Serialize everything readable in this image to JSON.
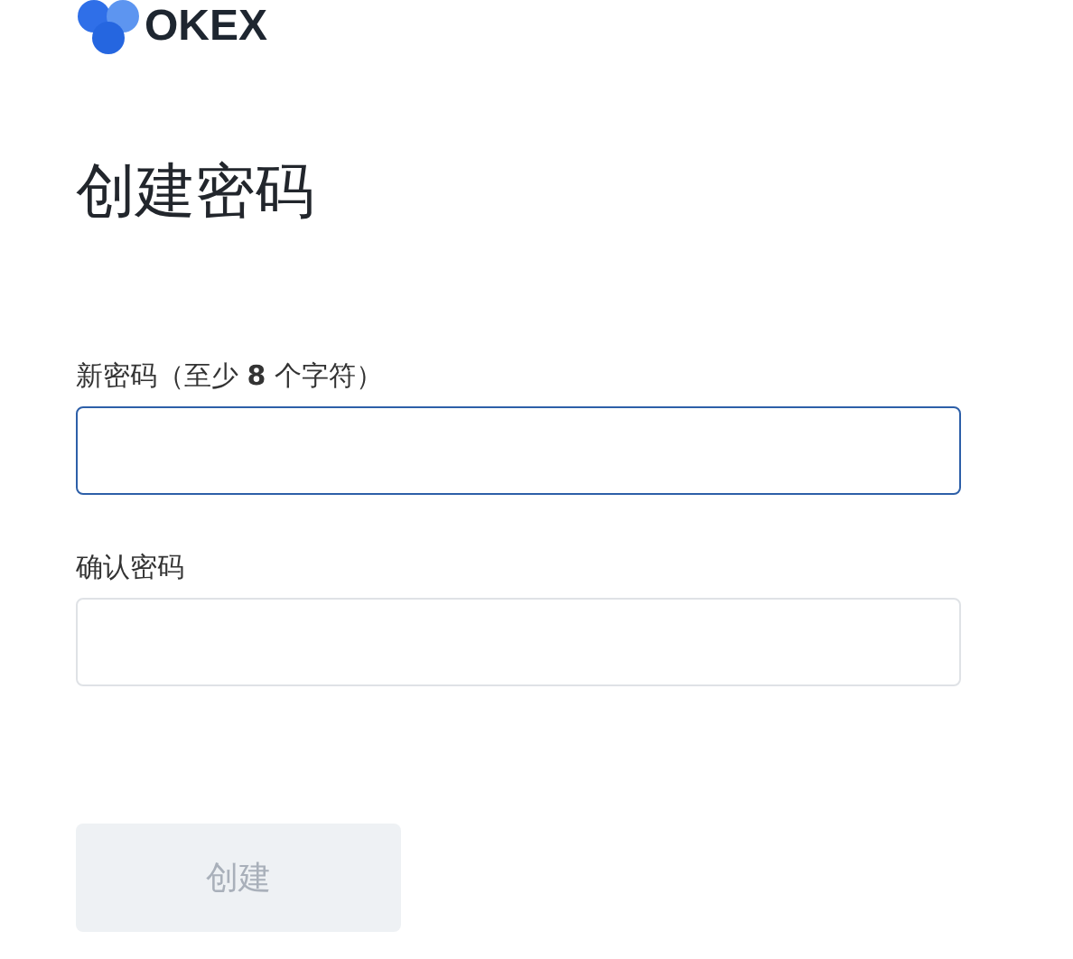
{
  "logo": {
    "text": "OKEX"
  },
  "title": "创建密码",
  "fields": [
    {
      "label": "新密码（至少 **8** 个字符）",
      "focused": true
    },
    {
      "label": "确认密码",
      "focused": false
    }
  ],
  "button": {
    "label": "创建",
    "disabled": true
  }
}
